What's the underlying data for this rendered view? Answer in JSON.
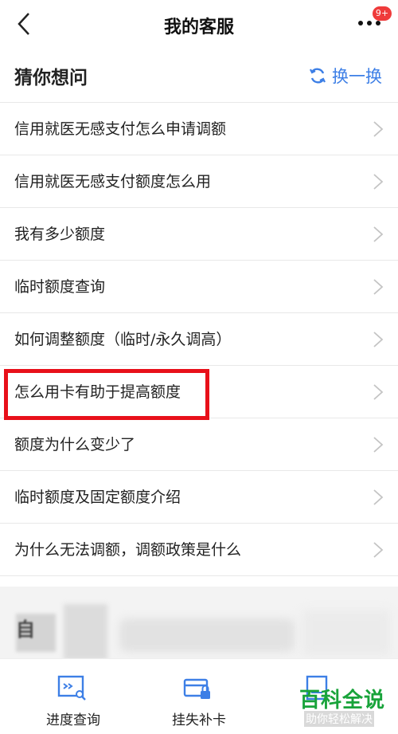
{
  "header": {
    "title": "我的客服",
    "badge": "9+"
  },
  "section": {
    "title": "猜你想问",
    "refresh_label": "换一换"
  },
  "questions": [
    "信用就医无感支付怎么申请调额",
    "信用就医无感支付额度怎么用",
    "我有多少额度",
    "临时额度查询",
    "如何调整额度（临时/永久调高）",
    "怎么用卡有助于提高额度",
    "额度为什么变少了",
    "临时额度及固定额度介绍",
    "为什么无法调额，调额政策是什么"
  ],
  "blurred_text": "自",
  "tabs": [
    {
      "label": "进度查询",
      "icon": "search-doc-icon"
    },
    {
      "label": "挂失补卡",
      "icon": "card-lock-icon"
    },
    {
      "label": "",
      "icon": "doc-icon"
    }
  ],
  "watermark": {
    "title": "百科全说",
    "subtitle": "助你轻松解决"
  },
  "colors": {
    "accent": "#3d7fe6",
    "highlight": "#e8101a",
    "badge": "#ef3b3b",
    "watermark": "#18a33a"
  }
}
